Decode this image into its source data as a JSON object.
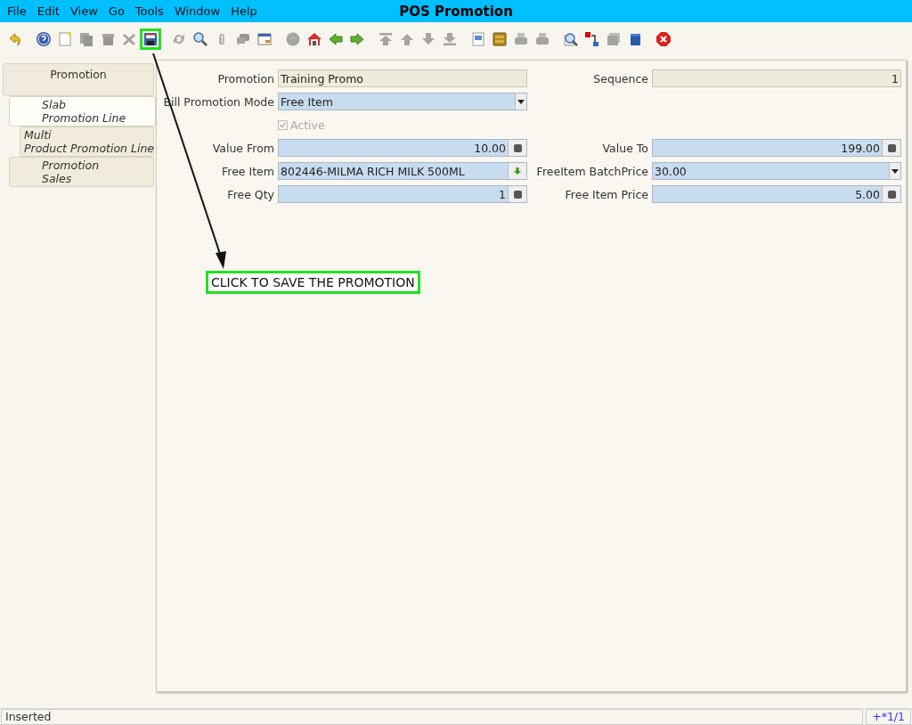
{
  "window": {
    "title": "POS Promotion"
  },
  "menu": [
    "File",
    "Edit",
    "View",
    "Go",
    "Tools",
    "Window",
    "Help"
  ],
  "toolbar": [
    [
      {
        "kind": "undo",
        "disabled": false,
        "highlighted": false
      }
    ],
    [
      {
        "kind": "help",
        "disabled": false,
        "highlighted": false
      },
      {
        "kind": "new",
        "disabled": false,
        "highlighted": false
      },
      {
        "kind": "copy",
        "disabled": true,
        "highlighted": false
      },
      {
        "kind": "delete",
        "disabled": true,
        "highlighted": false
      },
      {
        "kind": "delete-selected",
        "disabled": true,
        "highlighted": false
      },
      {
        "kind": "save",
        "disabled": false,
        "highlighted": true
      }
    ],
    [
      {
        "kind": "refresh",
        "disabled": true,
        "highlighted": false
      },
      {
        "kind": "find",
        "disabled": false,
        "highlighted": false
      },
      {
        "kind": "attach",
        "disabled": true,
        "highlighted": false
      },
      {
        "kind": "chat",
        "disabled": true,
        "highlighted": false
      },
      {
        "kind": "grid",
        "disabled": false,
        "highlighted": false
      }
    ],
    [
      {
        "kind": "history",
        "disabled": true,
        "highlighted": false
      },
      {
        "kind": "home",
        "disabled": false,
        "highlighted": false
      },
      {
        "kind": "back",
        "disabled": false,
        "highlighted": false
      },
      {
        "kind": "forward",
        "disabled": false,
        "highlighted": false
      }
    ],
    [
      {
        "kind": "first",
        "disabled": true,
        "highlighted": false
      },
      {
        "kind": "previous",
        "disabled": true,
        "highlighted": false
      },
      {
        "kind": "next",
        "disabled": true,
        "highlighted": false
      },
      {
        "kind": "last",
        "disabled": true,
        "highlighted": false
      }
    ],
    [
      {
        "kind": "report",
        "disabled": false,
        "highlighted": false
      },
      {
        "kind": "archive",
        "disabled": false,
        "highlighted": false
      },
      {
        "kind": "print-preview",
        "disabled": true,
        "highlighted": false
      },
      {
        "kind": "print",
        "disabled": true,
        "highlighted": false
      }
    ],
    [
      {
        "kind": "zoom-across",
        "disabled": false,
        "highlighted": false
      },
      {
        "kind": "workflow",
        "disabled": false,
        "highlighted": false
      },
      {
        "kind": "request",
        "disabled": true,
        "highlighted": false
      },
      {
        "kind": "product",
        "disabled": false,
        "highlighted": false
      }
    ],
    [
      {
        "kind": "close",
        "disabled": false,
        "highlighted": false
      }
    ]
  ],
  "tabs": [
    {
      "lines": [
        "Promotion"
      ],
      "selected": false,
      "children": [
        {
          "lines": [
            "Slab",
            "Promotion Line"
          ],
          "selected": true,
          "children": [
            {
              "lines": [
                "Multi",
                "Product Promotion Line"
              ],
              "selected": false
            }
          ]
        },
        {
          "lines": [
            "Promotion",
            "Sales"
          ],
          "selected": false
        }
      ]
    }
  ],
  "form": [
    {
      "left": {
        "kind": "readonly",
        "label": "Promotion",
        "value": "Training Promo"
      },
      "right": {
        "kind": "readonly-number",
        "label": "Sequence",
        "value": "1"
      }
    },
    {
      "left": {
        "kind": "combo",
        "label": "Bill Promotion Mode",
        "value": "Free Item"
      }
    },
    {
      "left": {
        "kind": "checkbox",
        "label": "Active",
        "checked": true,
        "disabled": true
      }
    },
    {
      "left": {
        "kind": "number",
        "label": "Value From",
        "value": "10.00"
      },
      "right": {
        "kind": "number",
        "label": "Value To",
        "value": "199.00"
      }
    },
    {
      "left": {
        "kind": "search",
        "label": "Free Item",
        "value": "802446-MILMA RICH MILK 500ML"
      },
      "right": {
        "kind": "combo",
        "label": "FreeItem BatchPrice",
        "value": "30.00"
      }
    },
    {
      "left": {
        "kind": "number",
        "label": "Free Qty",
        "value": "1"
      },
      "right": {
        "kind": "number",
        "label": "Free Item Price",
        "value": "5.00"
      }
    }
  ],
  "callout": {
    "text": "CLICK TO SAVE THE PROMOTION"
  },
  "status_bar": {
    "message": "Inserted",
    "record": "+*1/1"
  }
}
